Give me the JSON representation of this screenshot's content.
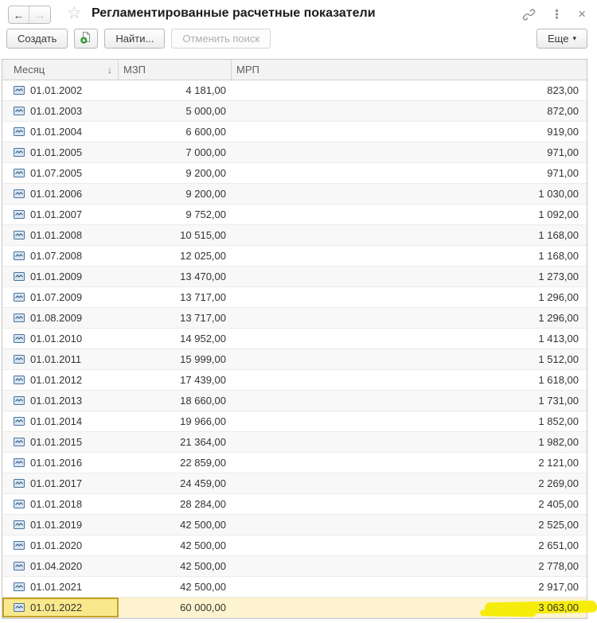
{
  "window": {
    "title": "Регламентированные расчетные показатели"
  },
  "icons": {
    "back": "←",
    "forward": "→",
    "star": "☆",
    "menu": "⋮",
    "close": "×",
    "sort_desc": "↓",
    "more_arrow": "▾"
  },
  "toolbar": {
    "create_label": "Создать",
    "find_label": "Найти...",
    "cancel_search_label": "Отменить поиск",
    "more_label": "Еще"
  },
  "colors": {
    "marker_yellow": "#f6ec0b",
    "selected_row_bg": "#fdf3cf",
    "current_cell_bg": "#fae98c",
    "current_cell_border": "#c4a02a",
    "row_icon_blue": "#46729e",
    "create_badge_green": "#3aa53a"
  },
  "table": {
    "columns": [
      {
        "label": "Месяц"
      },
      {
        "label": "МЗП"
      },
      {
        "label": "МРП"
      }
    ],
    "sorted_column": "Месяц",
    "sort_indicator": "↓",
    "selected_row_index": 25,
    "rows": [
      {
        "month": "01.01.2002",
        "mzp": "4 181,00",
        "mrp": "823,00"
      },
      {
        "month": "01.01.2003",
        "mzp": "5 000,00",
        "mrp": "872,00"
      },
      {
        "month": "01.01.2004",
        "mzp": "6 600,00",
        "mrp": "919,00"
      },
      {
        "month": "01.01.2005",
        "mzp": "7 000,00",
        "mrp": "971,00"
      },
      {
        "month": "01.07.2005",
        "mzp": "9 200,00",
        "mrp": "971,00"
      },
      {
        "month": "01.01.2006",
        "mzp": "9 200,00",
        "mrp": "1 030,00"
      },
      {
        "month": "01.01.2007",
        "mzp": "9 752,00",
        "mrp": "1 092,00"
      },
      {
        "month": "01.01.2008",
        "mzp": "10 515,00",
        "mrp": "1 168,00"
      },
      {
        "month": "01.07.2008",
        "mzp": "12 025,00",
        "mrp": "1 168,00"
      },
      {
        "month": "01.01.2009",
        "mzp": "13 470,00",
        "mrp": "1 273,00"
      },
      {
        "month": "01.07.2009",
        "mzp": "13 717,00",
        "mrp": "1 296,00"
      },
      {
        "month": "01.08.2009",
        "mzp": "13 717,00",
        "mrp": "1 296,00"
      },
      {
        "month": "01.01.2010",
        "mzp": "14 952,00",
        "mrp": "1 413,00"
      },
      {
        "month": "01.01.2011",
        "mzp": "15 999,00",
        "mrp": "1 512,00"
      },
      {
        "month": "01.01.2012",
        "mzp": "17 439,00",
        "mrp": "1 618,00"
      },
      {
        "month": "01.01.2013",
        "mzp": "18 660,00",
        "mrp": "1 731,00"
      },
      {
        "month": "01.01.2014",
        "mzp": "19 966,00",
        "mrp": "1 852,00"
      },
      {
        "month": "01.01.2015",
        "mzp": "21 364,00",
        "mrp": "1 982,00"
      },
      {
        "month": "01.01.2016",
        "mzp": "22 859,00",
        "mrp": "2 121,00"
      },
      {
        "month": "01.01.2017",
        "mzp": "24 459,00",
        "mrp": "2 269,00"
      },
      {
        "month": "01.01.2018",
        "mzp": "28 284,00",
        "mrp": "2 405,00"
      },
      {
        "month": "01.01.2019",
        "mzp": "42 500,00",
        "mrp": "2 525,00"
      },
      {
        "month": "01.01.2020",
        "mzp": "42 500,00",
        "mrp": "2 651,00"
      },
      {
        "month": "01.04.2020",
        "mzp": "42 500,00",
        "mrp": "2 778,00"
      },
      {
        "month": "01.01.2021",
        "mzp": "42 500,00",
        "mrp": "2 917,00"
      },
      {
        "month": "01.01.2022",
        "mzp": "60 000,00",
        "mrp": "3 063,00"
      }
    ]
  }
}
